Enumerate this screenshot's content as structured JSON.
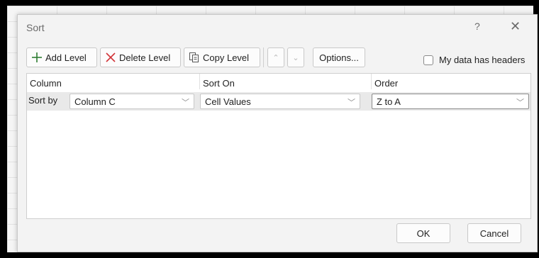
{
  "dialog": {
    "title": "Sort",
    "help": "?",
    "close": "✕"
  },
  "toolbar": {
    "add_level": "Add Level",
    "delete_level": "Delete Level",
    "copy_level": "Copy Level",
    "move_up": "⌃",
    "move_down": "⌄",
    "options": "Options..."
  },
  "headers_checkbox": {
    "label": "My data has headers",
    "checked": false
  },
  "columns": {
    "column": "Column",
    "sort_on": "Sort On",
    "order": "Order"
  },
  "rows": [
    {
      "label": "Sort by",
      "column": "Column C",
      "sort_on": "Cell Values",
      "order": "Z to A"
    }
  ],
  "footer": {
    "ok": "OK",
    "cancel": "Cancel"
  },
  "colors": {
    "add_icon": "#2e7d32",
    "delete_icon": "#d13438"
  }
}
